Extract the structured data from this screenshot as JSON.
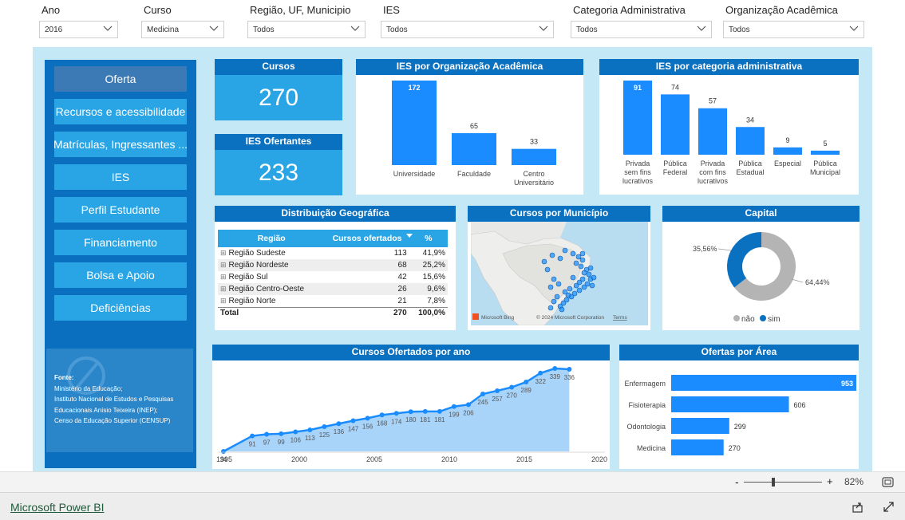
{
  "filters": [
    {
      "label": "Ano",
      "value": "2016"
    },
    {
      "label": "Curso",
      "value": "Medicina"
    },
    {
      "label": "Região, UF, Municipio",
      "value": "Todos"
    },
    {
      "label": "IES",
      "value": "Todos"
    },
    {
      "label": "Categoria Administrativa",
      "value": "Todos"
    },
    {
      "label": "Organização Acadêmica",
      "value": "Todos"
    }
  ],
  "sidebar": {
    "items": [
      {
        "label": "Oferta",
        "active": true
      },
      {
        "label": "Recursos e acessibilidade"
      },
      {
        "label": "Matrículas, Ingressantes ..."
      },
      {
        "label": "IES"
      },
      {
        "label": "Perfil Estudante"
      },
      {
        "label": "Financiamento"
      },
      {
        "label": "Bolsa e Apoio"
      },
      {
        "label": "Deficiências"
      }
    ],
    "source": {
      "title": "Fonte:",
      "lines": [
        "Ministério da Educação;",
        "Instituto Nacional de Estudos e Pesquisas",
        "Educacionais Anísio Teixeira (INEP);",
        "Censo da Educação Superior (CENSUP)"
      ]
    }
  },
  "kpis": {
    "cursos": {
      "title": "Cursos",
      "value": "270"
    },
    "ies": {
      "title": "IES Ofertantes",
      "value": "233"
    }
  },
  "colors": {
    "bar": "#1a8cff",
    "header": "#0a70c0",
    "tile": "#29a5e5",
    "donut_sim": "#0a70c0",
    "donut_nao": "#b4b4b4"
  },
  "org_chart": {
    "title": "IES por Organização Acadêmica",
    "chart_data": {
      "type": "bar",
      "categories": [
        [
          "Universidade"
        ],
        [
          "Faculdade"
        ],
        [
          "Centro",
          "Universitário"
        ]
      ],
      "values": [
        172,
        65,
        33
      ]
    }
  },
  "cat_chart": {
    "title": "IES por categoria administrativa",
    "chart_data": {
      "type": "bar",
      "categories": [
        [
          "Privada",
          "sem fins",
          "lucrativos"
        ],
        [
          "Pública",
          "Federal"
        ],
        [
          "Privada",
          "com fins",
          "lucrativos"
        ],
        [
          "Pública",
          "Estadual"
        ],
        [
          "Especial"
        ],
        [
          "Pública",
          "Municipal"
        ]
      ],
      "values": [
        91,
        74,
        57,
        34,
        9,
        5
      ]
    }
  },
  "geo": {
    "title": "Distribuição Geográfica",
    "columns": [
      "Região",
      "Cursos ofertados",
      "%"
    ],
    "rows": [
      {
        "regiao": "Região Sudeste",
        "cursos": "113",
        "pct": "41,9%"
      },
      {
        "regiao": "Região Nordeste",
        "cursos": "68",
        "pct": "25,2%"
      },
      {
        "regiao": "Região Sul",
        "cursos": "42",
        "pct": "15,6%"
      },
      {
        "regiao": "Região Centro-Oeste",
        "cursos": "26",
        "pct": "9,6%"
      },
      {
        "regiao": "Região Norte",
        "cursos": "21",
        "pct": "7,8%"
      }
    ],
    "total": {
      "label": "Total",
      "cursos": "270",
      "pct": "100,0%"
    }
  },
  "map": {
    "title": "Cursos por Município",
    "bing": "Microsoft Bing",
    "copyright": "© 2024 Microsoft Corporation",
    "terms": "Terms"
  },
  "capital": {
    "title": "Capital",
    "chart_data": {
      "type": "pie",
      "labels": [
        "não",
        "sim"
      ],
      "values": [
        64.44,
        35.56
      ],
      "value_labels": [
        "64,44%",
        "35,56%"
      ]
    },
    "legend": [
      "não",
      "sim"
    ]
  },
  "year_chart": {
    "title": "Cursos Ofertados por ano",
    "chart_data": {
      "type": "area",
      "x": [
        1995,
        1996,
        1997,
        1998,
        1999,
        2000,
        2001,
        2002,
        2003,
        2004,
        2005,
        2006,
        2007,
        2008,
        2009,
        2010,
        2011,
        2012,
        2013,
        2014,
        2015,
        2016,
        2017,
        2018,
        2019,
        2020
      ],
      "values": [
        34,
        null,
        91,
        97,
        99,
        106,
        113,
        125,
        136,
        147,
        156,
        168,
        174,
        180,
        181,
        181,
        199,
        206,
        245,
        257,
        270,
        289,
        322,
        339,
        336
      ],
      "xticks": [
        "1995",
        "2000",
        "2005",
        "2010",
        "2015",
        "2020"
      ]
    }
  },
  "area_chart": {
    "title": "Ofertas por Área",
    "chart_data": {
      "type": "bar",
      "orientation": "horizontal",
      "categories": [
        "Enfermagem",
        "Fisioterapia",
        "Odontologia",
        "Medicina"
      ],
      "values": [
        953,
        606,
        299,
        270
      ]
    }
  },
  "zoom": {
    "minus": "-",
    "plus": "+",
    "level": "82%"
  },
  "footer": {
    "brand": "Microsoft Power BI"
  }
}
